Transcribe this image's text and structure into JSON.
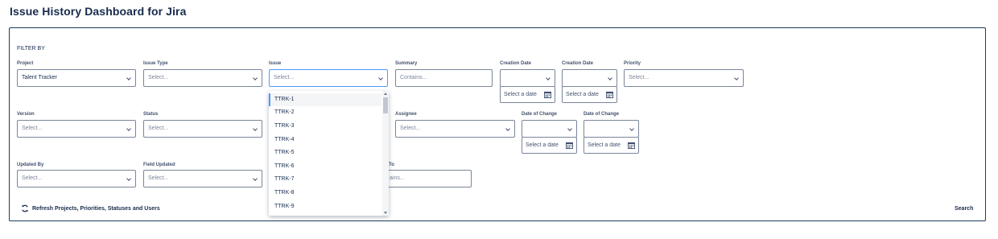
{
  "page": {
    "title": "Issue History Dashboard for Jira"
  },
  "filter": {
    "heading": "FILTER BY",
    "project": {
      "label": "Project",
      "value": "Talent Tracker"
    },
    "issue_type": {
      "label": "Issue Type",
      "placeholder": "Select..."
    },
    "issue": {
      "label": "Issue",
      "placeholder": "Select..."
    },
    "summary": {
      "label": "Summary",
      "placeholder": "Contains..."
    },
    "creation_date_from": {
      "label": "Creation Date",
      "date_placeholder": "Select a date"
    },
    "creation_date_to": {
      "label": "Creation Date",
      "date_placeholder": "Select a date"
    },
    "priority": {
      "label": "Priority",
      "placeholder": "Select..."
    },
    "version": {
      "label": "Version",
      "placeholder": "Select..."
    },
    "status": {
      "label": "Status",
      "placeholder": "Select..."
    },
    "assignee": {
      "label": "Assignee",
      "placeholder": "Select..."
    },
    "date_of_change_from": {
      "label": "Date of Change",
      "date_placeholder": "Select a date"
    },
    "date_of_change_to": {
      "label": "Date of Change",
      "date_placeholder": "Select a date"
    },
    "updated_by": {
      "label": "Updated By",
      "placeholder": "Select..."
    },
    "field_updated": {
      "label": "Field Updated",
      "placeholder": "Select..."
    },
    "to": {
      "label": "To",
      "placeholder": "ains..."
    }
  },
  "issue_dropdown": {
    "options": [
      "TTRK-1",
      "TTRK-2",
      "TTRK-3",
      "TTRK-4",
      "TTRK-5",
      "TTRK-6",
      "TTRK-7",
      "TTRK-8",
      "TTRK-9"
    ],
    "highlighted": "TTRK-1"
  },
  "actions": {
    "refresh_label": "Refresh Projects, Priorities, Statuses and Users",
    "search_label": "Search"
  },
  "colors": {
    "border": "#7a869a",
    "focus": "#4c9aff",
    "panel_border": "#1f3b5c"
  },
  "icons": {
    "refresh": "refresh-icon",
    "calendar": "calendar-icon",
    "chevron": "chevron-down-icon"
  }
}
